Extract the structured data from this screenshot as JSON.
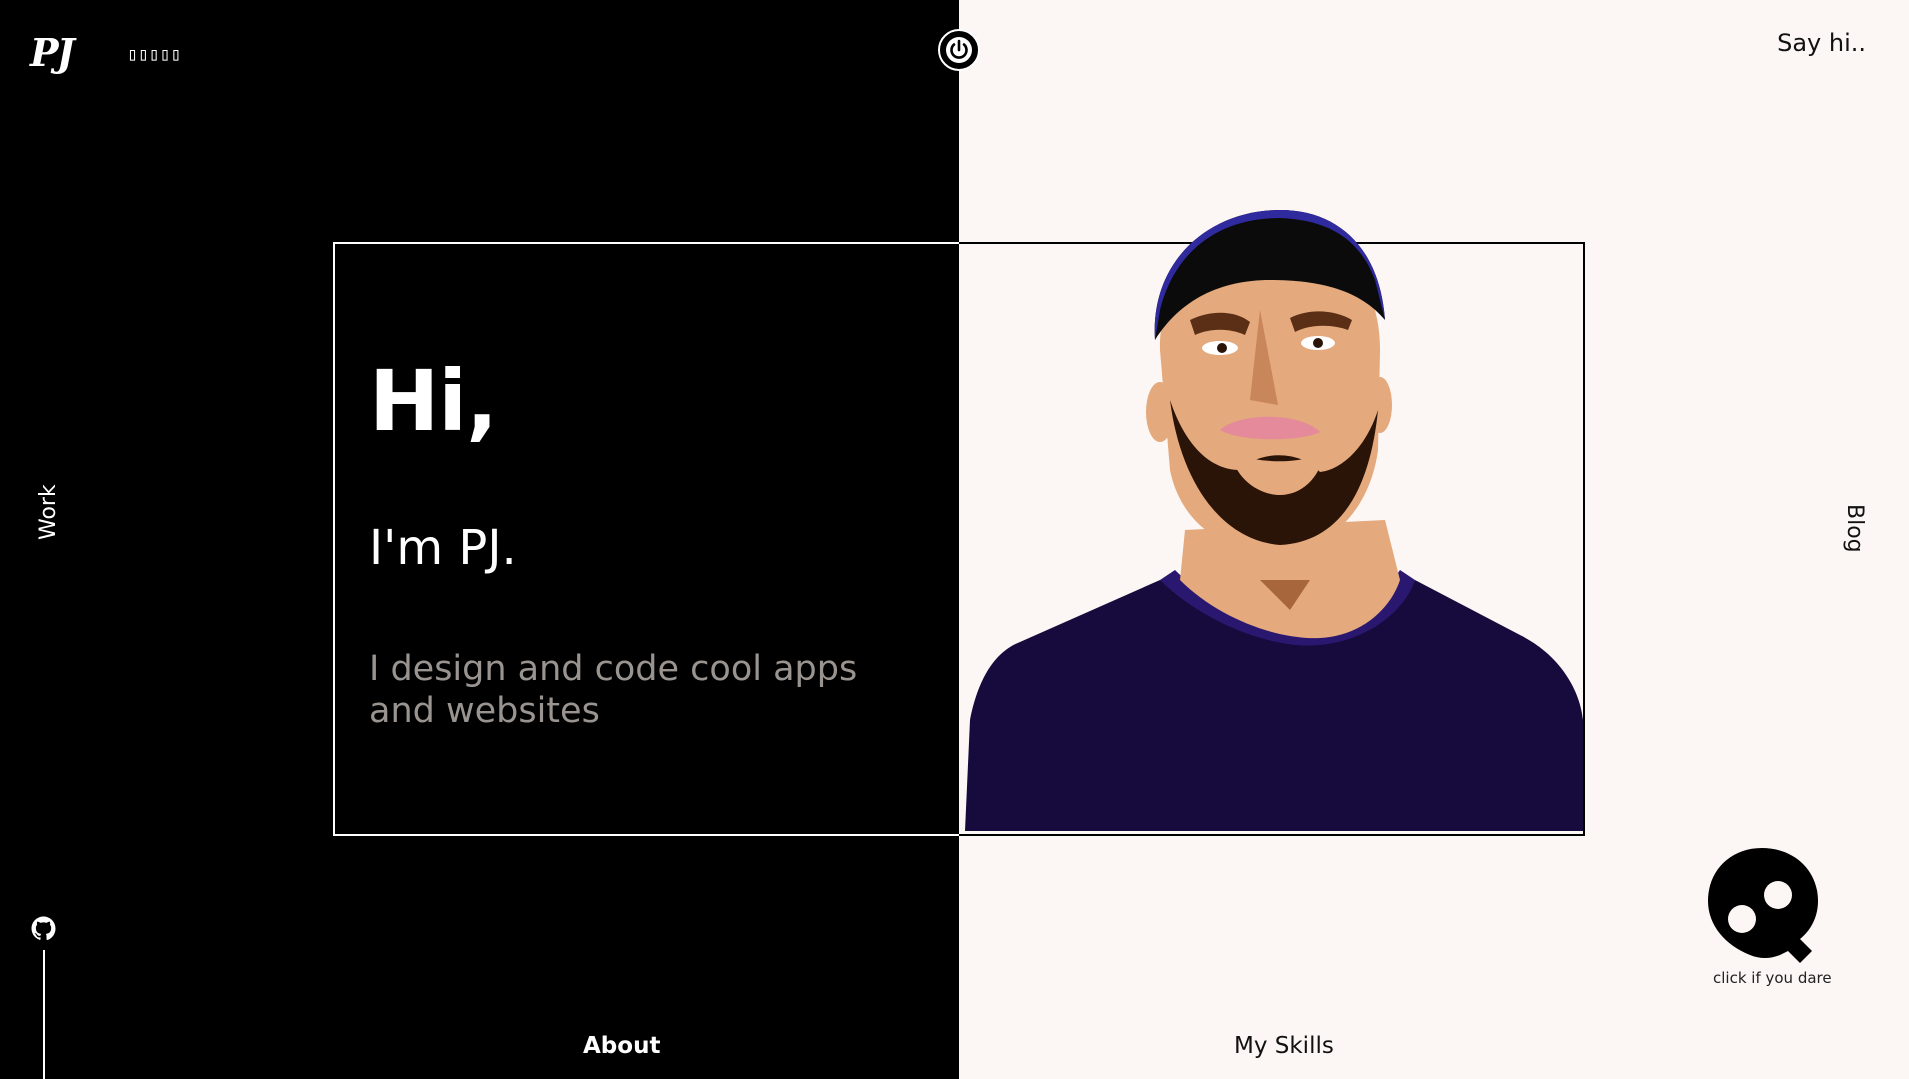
{
  "header": {
    "logo": "PJ",
    "lang_glyphs": "▯▯▯▯▯",
    "say_hi": "Say hi.."
  },
  "nav": {
    "work": "Work",
    "blog": "Blog",
    "about": "About",
    "skills": "My Skills"
  },
  "hero": {
    "greeting": "Hi,",
    "name": "I'm PJ.",
    "tagline": "I design and code cool apps and websites"
  },
  "easter_egg": {
    "caption": "click if you dare"
  },
  "colors": {
    "dark": "#000000",
    "light": "#fcf6f4",
    "tagline": "#9a9490",
    "shirt": "#170a3d",
    "cap": "#2f2a9e"
  },
  "icons": {
    "power": "power-icon",
    "github": "github-icon",
    "skull": "skull-icon"
  }
}
